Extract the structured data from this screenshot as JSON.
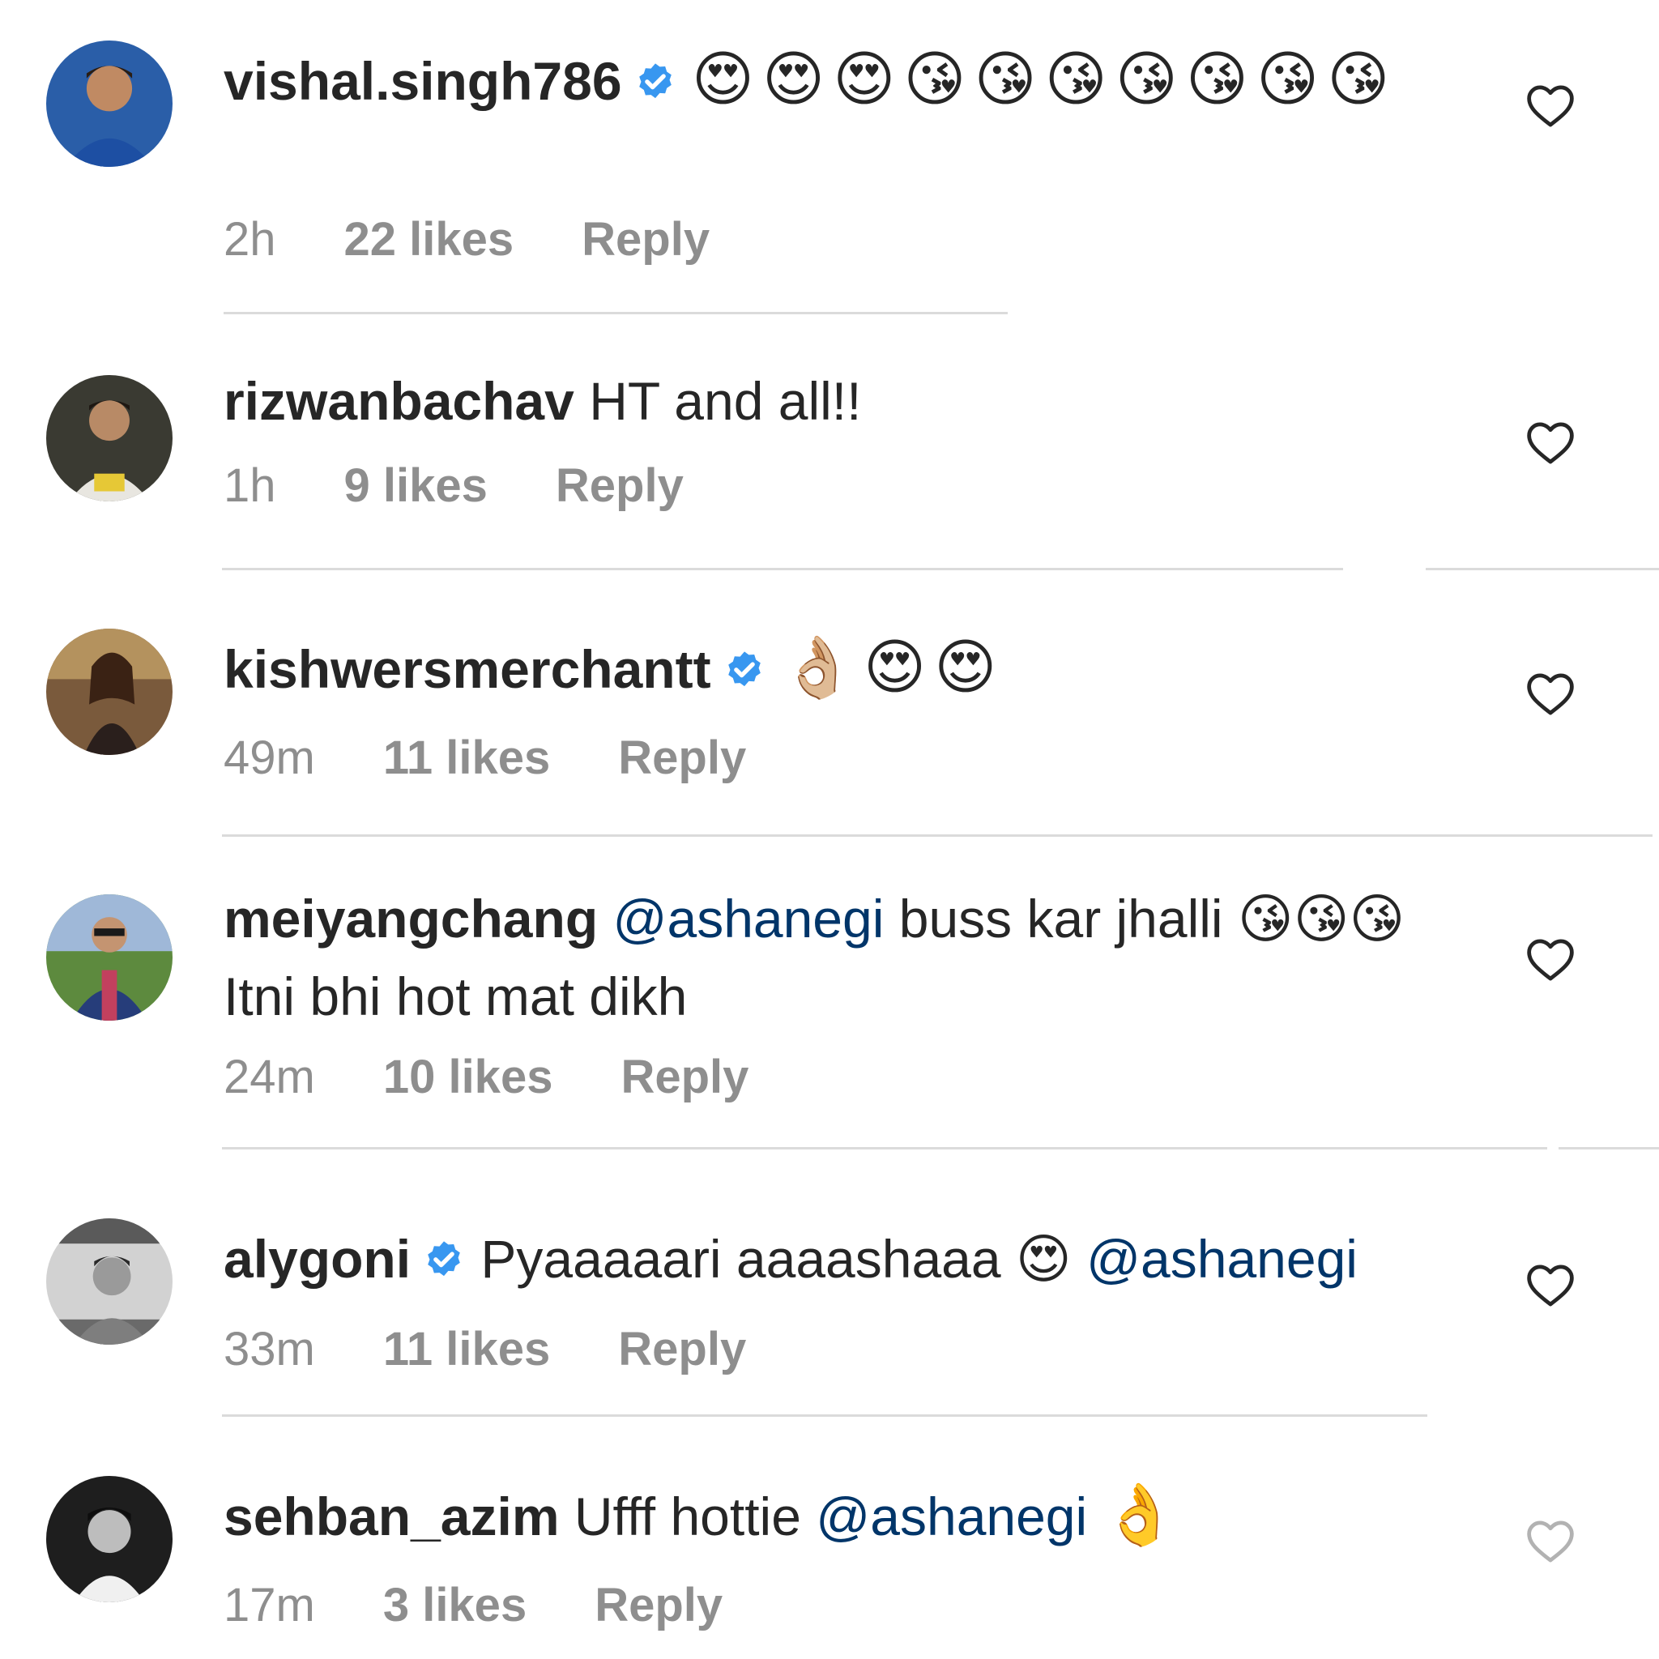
{
  "comments": [
    {
      "username": "vishal.singh786",
      "verified": true,
      "text": "😍😍😍😘😘😘😘😘😘😘",
      "mention": "",
      "suffix": "",
      "time": "2h",
      "likes": "22 likes",
      "reply": "Reply"
    },
    {
      "username": "rizwanbachav",
      "verified": false,
      "text": "HT and all!!",
      "mention": "",
      "suffix": "",
      "time": "1h",
      "likes": "9 likes",
      "reply": "Reply"
    },
    {
      "username": "kishwersmerchantt",
      "verified": true,
      "text": "👌🏼😍😍",
      "mention": "",
      "suffix": "",
      "time": "49m",
      "likes": "11 likes",
      "reply": "Reply"
    },
    {
      "username": "meiyangchang",
      "verified": false,
      "text": "",
      "mention": "@ashanegi",
      "suffix": "buss kar jhalli 😘😘😘 Itni bhi hot mat dikh",
      "time": "24m",
      "likes": "10 likes",
      "reply": "Reply"
    },
    {
      "username": "alygoni",
      "verified": true,
      "text": "Pyaaaaari aaaashaaa 😍",
      "mention": "@ashanegi",
      "suffix": "",
      "time": "33m",
      "likes": "11 likes",
      "reply": "Reply"
    },
    {
      "username": "sehban_azim",
      "verified": false,
      "text": "Ufff hottie",
      "mention": "@ashanegi",
      "suffix": "👌",
      "time": "17m",
      "likes": "3 likes",
      "reply": "Reply"
    }
  ],
  "icons": {
    "verified": "verified-badge-icon",
    "like": "heart-outline-icon"
  },
  "colors": {
    "username": "#262626",
    "mention": "#003569",
    "meta": "#8e8e8e",
    "verified": "#3897f0",
    "divider": "#dbdbdb"
  }
}
